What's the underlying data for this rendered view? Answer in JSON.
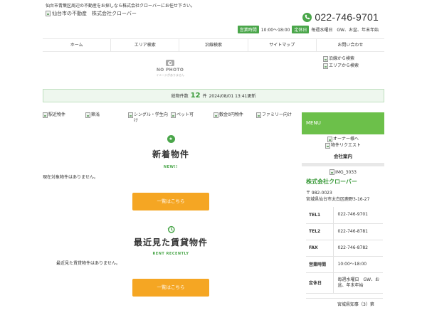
{
  "header": {
    "tagline": "仙台市青葉区周辺の不動産をお探しなら株式会社クローバーにお任せ下さい。",
    "logo_alt": "仙台市の不動産　株式会社クローバー",
    "phone": "022-746-9701",
    "hours_label": "営業時間",
    "hours_value": "10:00～18:00",
    "holiday_label": "定休日",
    "holiday_value": "毎週水曜日　GW、お盆、年末年始"
  },
  "nav": [
    {
      "label": "ホーム"
    },
    {
      "label": "エリア検索"
    },
    {
      "label": "沿線検索"
    },
    {
      "label": "サイトマップ"
    },
    {
      "label": "お問い合わせ"
    }
  ],
  "nophoto": {
    "title": "NO PHOTO",
    "sub": "イメージがありません"
  },
  "search_links": {
    "line": "沿線から検索",
    "area": "エリアから検索"
  },
  "count_bar": {
    "label": "総物件数",
    "count": "12",
    "unit": "件",
    "updated": "2024/08/01 13:41更新"
  },
  "categories": [
    {
      "label": "駅近物件"
    },
    {
      "label": "築浅"
    },
    {
      "label": "シングル・学生向け"
    },
    {
      "label": "ペット可"
    },
    {
      "label": "敷金0円物件"
    },
    {
      "label": "ファミリー向け"
    }
  ],
  "new_section": {
    "title": "新着物件",
    "sub": "NEW!!",
    "empty": "現在対象物件はありません。",
    "button": "一覧はこちら"
  },
  "recent_section": {
    "title": "最近見た賃貸物件",
    "sub": "RENT RECENTLY",
    "empty": "最近見た賃貸物件はありません。",
    "button": "一覧はこちら"
  },
  "sidebar": {
    "menu": "MENU",
    "owner": "オーナー様へ",
    "request": "物件リクエスト",
    "about": "会社案内",
    "image_alt": "IMG_3033",
    "company": "株式会社クローバー",
    "postal": "〒 982-0023",
    "address": "宮城県仙台市太白区鹿野3-16-27",
    "info": [
      {
        "key": "TEL1",
        "value": "022-746-9701"
      },
      {
        "key": "TEL2",
        "value": "022-746-8781"
      },
      {
        "key": "FAX",
        "value": "022-746-8782"
      },
      {
        "key": "営業時間",
        "value": "10:00～18:00"
      },
      {
        "key": "定休日",
        "value": "毎週水曜日　GW、お盆、年末年始"
      }
    ],
    "partial": "宮城県知事（3）第"
  },
  "colors": {
    "green": "#4aa64a",
    "menu_green": "#6cc04a",
    "orange": "#f5a623"
  }
}
